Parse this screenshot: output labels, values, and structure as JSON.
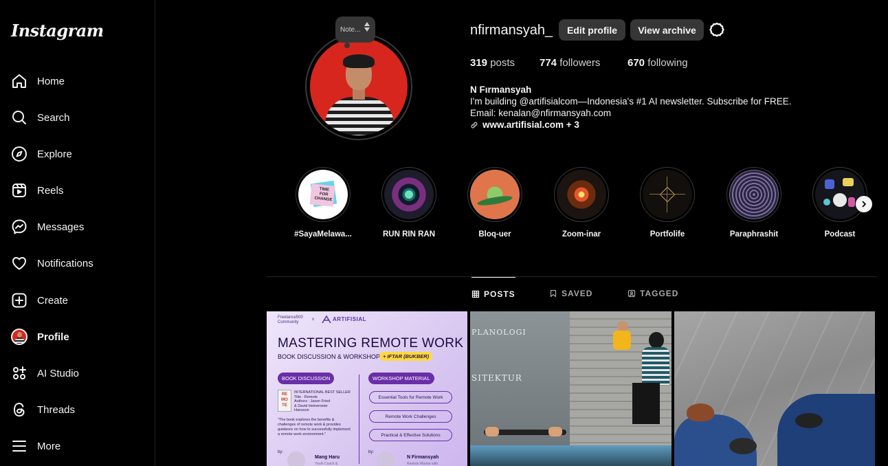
{
  "brand": {
    "logo": "Instagram"
  },
  "sidebar": {
    "items": [
      {
        "label": "Home",
        "icon": "home-icon"
      },
      {
        "label": "Search",
        "icon": "search-icon"
      },
      {
        "label": "Explore",
        "icon": "compass-icon"
      },
      {
        "label": "Reels",
        "icon": "reels-icon"
      },
      {
        "label": "Messages",
        "icon": "messenger-icon"
      },
      {
        "label": "Notifications",
        "icon": "heart-icon"
      },
      {
        "label": "Create",
        "icon": "plus-square-icon"
      },
      {
        "label": "Profile",
        "icon": "avatar"
      },
      {
        "label": "AI Studio",
        "icon": "ai-studio-icon"
      },
      {
        "label": "Threads",
        "icon": "threads-icon"
      },
      {
        "label": "More",
        "icon": "menu-icon"
      }
    ]
  },
  "note": {
    "text": "Note..."
  },
  "profile": {
    "username": "nfirmansyah_",
    "edit_label": "Edit profile",
    "archive_label": "View archive",
    "stats": {
      "posts_count": "319",
      "posts_label": "posts",
      "followers_count": "774",
      "followers_label": "followers",
      "following_count": "670",
      "following_label": "following"
    },
    "bio": {
      "name": "N Fırmansyah",
      "line1": "I'm building @artifisialcom—Indonesia's #1 AI newsletter. Subscribe for FREE.",
      "line2": "Email: kenalan@nfirmansyah.com",
      "link": "www.artifisial.com + 3"
    }
  },
  "highlights": [
    {
      "label": "#SayaMelawa..."
    },
    {
      "label": "RUN RIN RAN"
    },
    {
      "label": "Bloq-uer"
    },
    {
      "label": "Zoom-inar"
    },
    {
      "label": "Portfolife"
    },
    {
      "label": "Paraphrashit"
    },
    {
      "label": "Podcast"
    }
  ],
  "tabs": [
    {
      "label": "POSTS",
      "icon": "grid-icon"
    },
    {
      "label": "SAVED",
      "icon": "bookmark-icon"
    },
    {
      "label": "TAGGED",
      "icon": "tagged-icon"
    }
  ],
  "post1": {
    "community": "Freelance500\nCommunity",
    "x": "x",
    "brand": "ARTIFISIAL",
    "title": "MASTERING REMOTE WORK",
    "subtitle": "BOOK DISCUSSION & WORKSHOP",
    "pill": "+ IFTAR (BUKBER)",
    "left_label": "BOOK DISCUSSION",
    "right_label": "WORKSHOP MATERIAL",
    "book_badge": "INTERNATIONAL BEST SELLER",
    "book_title": "Title    : Remote",
    "book_authors": "Authors : Jason Fried",
    "book_authors2": "& David Heinemeier",
    "book_authors3": "Hansson",
    "book_cover": "RE MO TE",
    "desc": "\"The book explores the benefits & challenges of remote work & provides guidance on how to successfully implement a remote work environment.\"",
    "ws1": "Essential Tools for Remote Work",
    "ws2": "Remote Work Challenges",
    "ws3": "Practical & Effective Solutions",
    "by": "by:",
    "speaker1": "Mang Haru",
    "speaker1_role": "Youth Coach &",
    "speaker2": "N Firmansyah",
    "speaker2_role": "Remote Worker with"
  },
  "post2": {
    "sign1": "PLANOLOGI",
    "sign2": "SITEKTUR"
  },
  "colors": {
    "background": "#000000",
    "button": "#363636",
    "accent_red": "#d7261e",
    "post1_bg": "#d9c8f1"
  }
}
